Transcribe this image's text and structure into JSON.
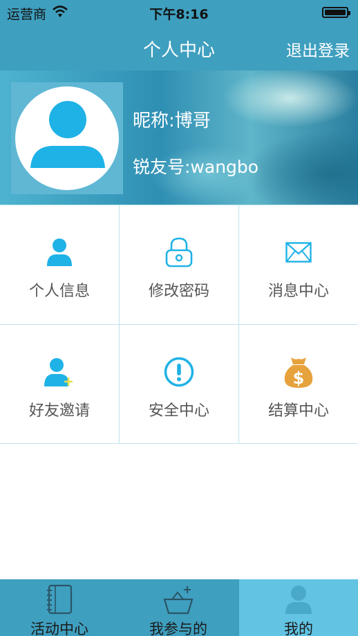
{
  "status_bar": {
    "carrier": "运营商",
    "time": "下午8:16"
  },
  "nav": {
    "title": "个人中心",
    "logout": "退出登录"
  },
  "profile": {
    "nickname": "昵称:博哥",
    "rui_id": "锐友号:wangbo"
  },
  "menu": [
    {
      "label": "个人信息",
      "icon": "person-icon"
    },
    {
      "label": "修改密码",
      "icon": "lock-icon"
    },
    {
      "label": "消息中心",
      "icon": "envelope-icon"
    },
    {
      "label": "好友邀请",
      "icon": "add-friend-icon"
    },
    {
      "label": "安全中心",
      "icon": "exclamation-icon"
    },
    {
      "label": "结算中心",
      "icon": "money-bag-icon"
    }
  ],
  "tabs": [
    {
      "label": "活动中心",
      "icon": "notebook-icon",
      "active": false
    },
    {
      "label": "我参与的",
      "icon": "basket-icon",
      "active": false
    },
    {
      "label": "我的",
      "icon": "user-icon",
      "active": true
    }
  ],
  "colors": {
    "header": "#3f9fbf",
    "accent": "#1fb2e6",
    "active_tab": "#62c3e3",
    "money": "#e6a23c"
  }
}
